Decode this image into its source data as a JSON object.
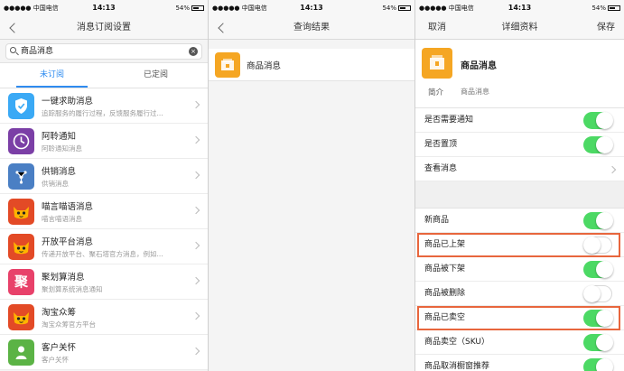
{
  "status": {
    "carrier": "●●●●● 中国电信",
    "time": "14:13",
    "battery": "54%"
  },
  "screen1": {
    "title": "消息订阅设置",
    "search_value": "商品消息",
    "tabs": [
      "未订阅",
      "已定阅"
    ],
    "items": [
      {
        "name": "一键求助消息",
        "desc": "追踪服务的履行过程，反馈服务履行过...",
        "icon": "shield-icon",
        "color": "#3aa9f5"
      },
      {
        "name": "阿聆通知",
        "desc": "阿聆通知消息",
        "icon": "clock-phone-icon",
        "color": "#7b3fa6"
      },
      {
        "name": "供销消息",
        "desc": "供销消息",
        "icon": "network-icon",
        "color": "#4a7fc4"
      },
      {
        "name": "喵言喵语消息",
        "desc": "喵言喵语消息",
        "icon": "tmall-cat-icon",
        "color": "#e34a26"
      },
      {
        "name": "开放平台消息",
        "desc": "传递开放平台、聚石塔官方消息，例如...",
        "icon": "tmall-cat-icon",
        "color": "#e34a26"
      },
      {
        "name": "聚划算消息",
        "desc": "聚划算系统消息通知",
        "icon": "ju-icon",
        "color": "#e8416a"
      },
      {
        "name": "淘宝众筹",
        "desc": "淘宝众筹官方平台",
        "icon": "tmall-cat-icon",
        "color": "#e34a26"
      },
      {
        "name": "客户关怀",
        "desc": "客户关怀",
        "icon": "person-icon",
        "color": "#5bb345"
      }
    ]
  },
  "screen2": {
    "title": "查询结果",
    "result": {
      "name": "商品消息",
      "icon": "folder-icon",
      "color": "#f5a623"
    }
  },
  "screen3": {
    "title": "详细资料",
    "cancel": "取消",
    "save": "保存",
    "profile": {
      "name": "商品消息",
      "intro_key": "简介",
      "intro_value": "商品消息"
    },
    "settings": [
      {
        "label": "是否需要通知",
        "on": true
      },
      {
        "label": "是否置顶",
        "on": true
      }
    ],
    "view_messages": "查看消息",
    "events": [
      {
        "label": "新商品",
        "on": true,
        "highlight": false
      },
      {
        "label": "商品已上架",
        "on": false,
        "highlight": true
      },
      {
        "label": "商品被下架",
        "on": true,
        "highlight": false
      },
      {
        "label": "商品被删除",
        "on": false,
        "highlight": false
      },
      {
        "label": "商品已卖空",
        "on": true,
        "highlight": true
      },
      {
        "label": "商品卖空（SKU）",
        "on": true,
        "highlight": false
      },
      {
        "label": "商品取消橱窗推荐",
        "on": true,
        "highlight": false
      }
    ]
  }
}
